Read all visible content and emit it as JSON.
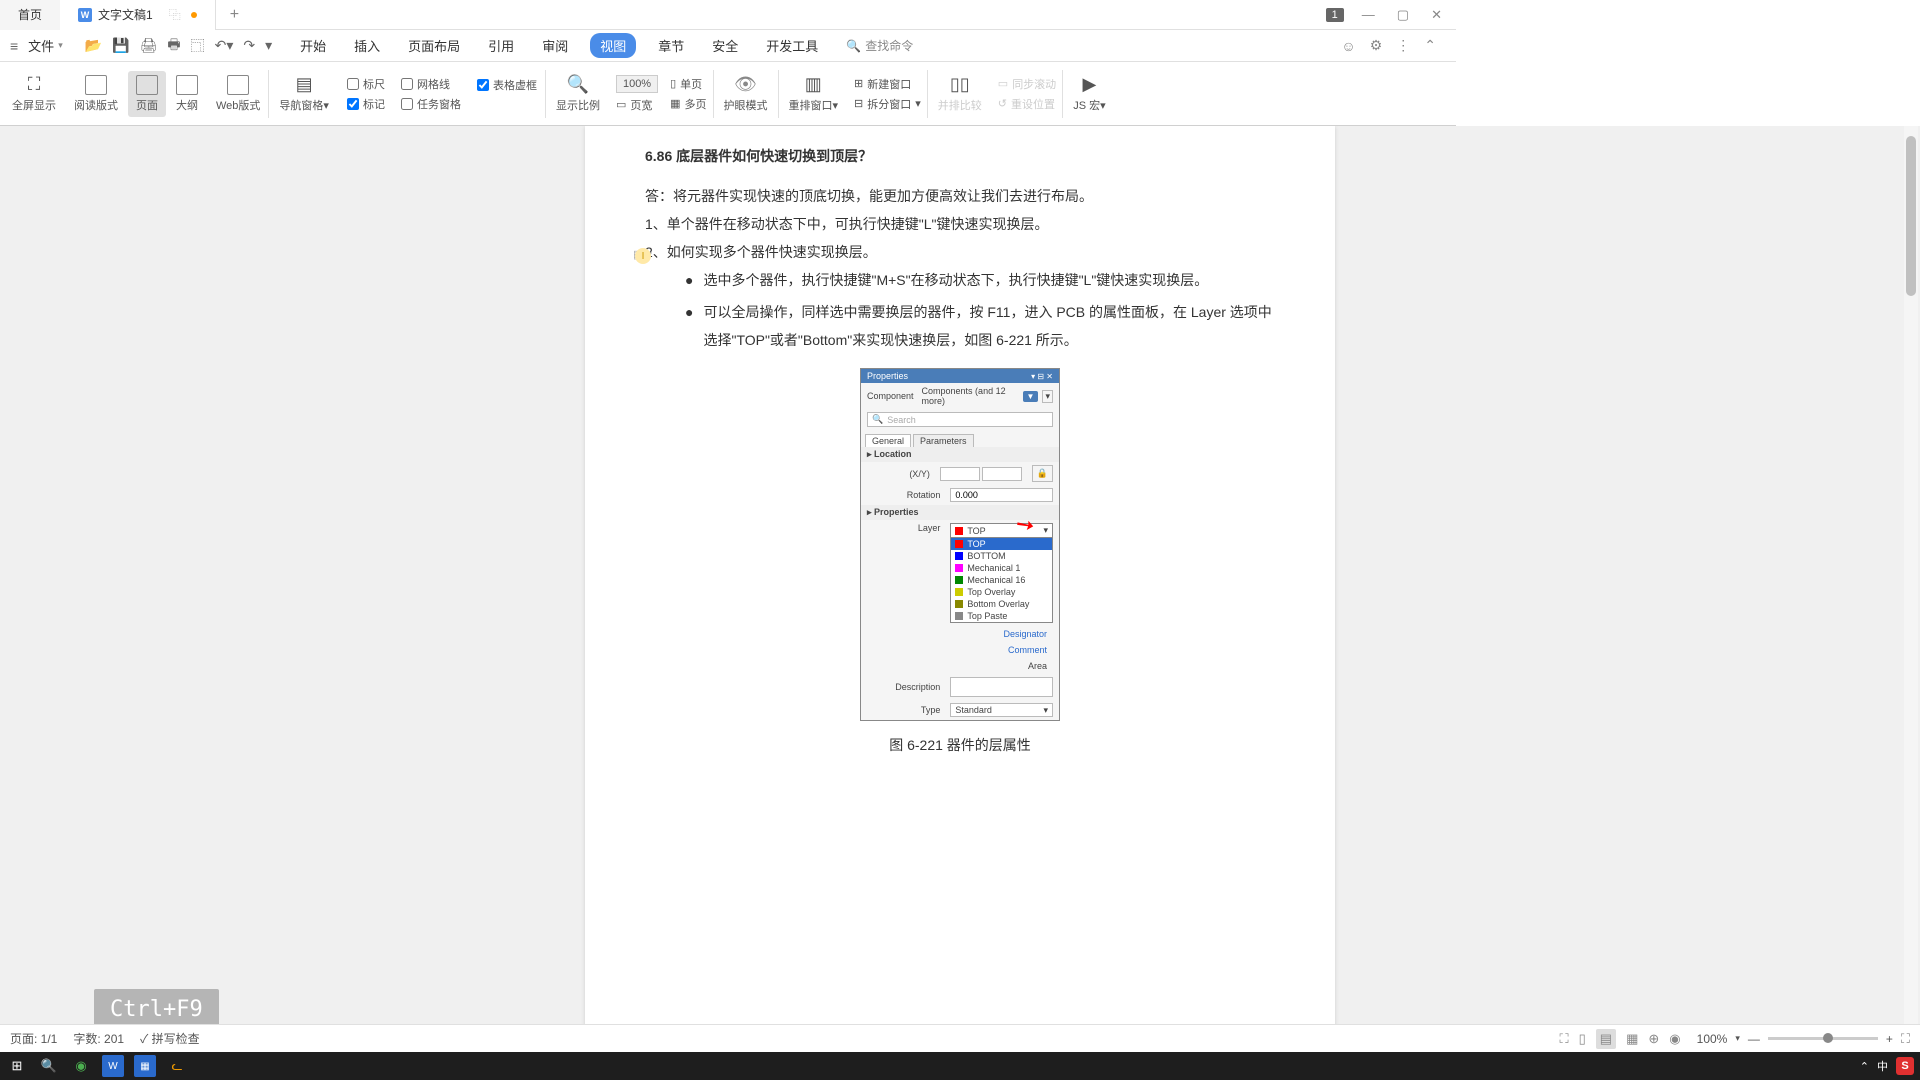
{
  "titlebar": {
    "home_tab": "首页",
    "doc_tab": "文字文稿1",
    "badge": "1"
  },
  "menubar": {
    "file": "文件",
    "tabs": [
      "开始",
      "插入",
      "页面布局",
      "引用",
      "审阅",
      "视图",
      "章节",
      "安全",
      "开发工具"
    ],
    "active_tab_index": 5,
    "search_placeholder": "查找命令"
  },
  "ribbon": {
    "fullscreen": "全屏显示",
    "reading": "阅读版式",
    "page": "页面",
    "outline": "大纲",
    "web": "Web版式",
    "nav_pane": "导航窗格",
    "ruler": "标尺",
    "gridlines": "网格线",
    "table_frame": "表格虚框",
    "marks": "标记",
    "task_pane": "任务窗格",
    "zoom": "显示比例",
    "zoom_val": "100%",
    "page_width": "页宽",
    "single_page": "单页",
    "multi_page": "多页",
    "eye_mode": "护眼模式",
    "rearrange": "重排窗口",
    "new_window": "新建窗口",
    "split": "拆分窗口",
    "side_by_side": "并排比较",
    "sync_scroll": "同步滚动",
    "reset_pos": "重设位置",
    "js_macro": "JS 宏"
  },
  "document": {
    "heading": "6.86  底层器件如何快速切换到顶层？",
    "p1": "答：将元器件实现快速的顶底切换，能更加方便高效让我们去进行布局。",
    "p2": "1、单个器件在移动状态下中，可执行快捷键\"L\"键快速实现换层。",
    "p3": "2、如何实现多个器件快速实现换层。",
    "b1": "选中多个器件，执行快捷键\"M+S\"在移动状态下，执行快捷键\"L\"键快速实现换层。",
    "b2": "可以全局操作，同样选中需要换层的器件，按 F11，进入 PCB 的属性面板，在 Layer 选项中选择\"TOP\"或者\"Bottom\"来实现快速换层，如图 6-221 所示。",
    "caption": "图 6-221 器件的层属性"
  },
  "props": {
    "title": "Properties",
    "component": "Component",
    "component_val": "Components (and 12 more)",
    "search": "Search",
    "tab_general": "General",
    "tab_params": "Parameters",
    "section_location": "Location",
    "xy": "(X/Y)",
    "rotation": "Rotation",
    "rotation_val": "0.000",
    "section_props": "Properties",
    "layer": "Layer",
    "designator": "Designator",
    "comment": "Comment",
    "area": "Area",
    "description": "Description",
    "type": "Type",
    "type_val": "Standard",
    "layer_selected": "TOP",
    "layer_options": [
      {
        "name": "TOP",
        "color": "#ff0000",
        "hl": true
      },
      {
        "name": "BOTTOM",
        "color": "#0000ff",
        "hl": false
      },
      {
        "name": "Mechanical 1",
        "color": "#ff00ff",
        "hl": false
      },
      {
        "name": "Mechanical 16",
        "color": "#008000",
        "hl": false
      },
      {
        "name": "Top Overlay",
        "color": "#cccc00",
        "hl": false
      },
      {
        "name": "Bottom Overlay",
        "color": "#808000",
        "hl": false
      },
      {
        "name": "Top Paste",
        "color": "#888888",
        "hl": false
      }
    ]
  },
  "overlay": {
    "keys": "Ctrl+F9"
  },
  "statusbar": {
    "page": "页面: 1/1",
    "words": "字数: 201",
    "spell": "拼写检查",
    "zoom": "100%"
  },
  "taskbar": {
    "ime": "中"
  }
}
